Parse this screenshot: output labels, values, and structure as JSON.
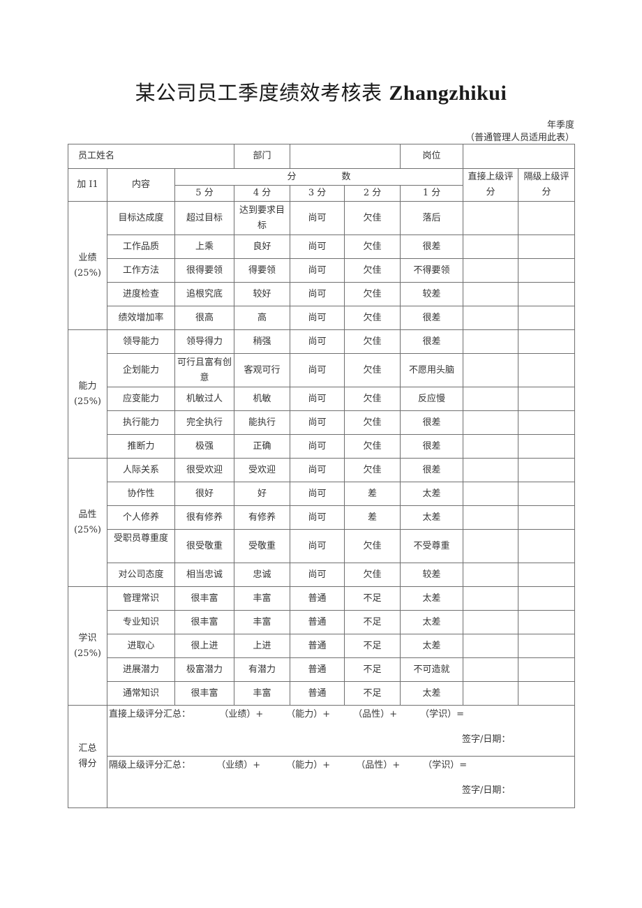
{
  "document": {
    "title_cn": "某公司员工季度绩效考核表",
    "title_latin": "Zhangzhikui",
    "season_label": "年季度",
    "applicability_note": "（普通管理人员适用此表）"
  },
  "header": {
    "employee_name_label": "员工姓名",
    "employee_name_value": "",
    "department_label": "部门",
    "department_value": "",
    "position_label": "岗位",
    "position_value": "",
    "item_label": "加 I1",
    "content_label": "内容",
    "score_group_label": "分　　　　　数",
    "score_columns": [
      "5 分",
      "4 分",
      "3 分",
      "2 分",
      "1 分"
    ],
    "direct_supervisor_label": "直接上级评分",
    "skip_supervisor_label": "隔级上级评分"
  },
  "categories": [
    {
      "name": "业绩",
      "weight": "(25%)",
      "items": [
        {
          "content": "目标达成度",
          "scores": [
            "超过目标",
            "达到要求目标",
            "尚可",
            "欠佳",
            "落后"
          ],
          "direct": "",
          "skip": ""
        },
        {
          "content": "工作品质",
          "scores": [
            "上乘",
            "良好",
            "尚可",
            "欠佳",
            "很差"
          ],
          "direct": "",
          "skip": ""
        },
        {
          "content": "工作方法",
          "scores": [
            "很得要领",
            "得要领",
            "尚可",
            "欠佳",
            "不得要领"
          ],
          "direct": "",
          "skip": ""
        },
        {
          "content": "进度检查",
          "scores": [
            "追根究底",
            "较好",
            "尚可",
            "欠佳",
            "较差"
          ],
          "direct": "",
          "skip": ""
        },
        {
          "content": "绩效增加率",
          "scores": [
            "很高",
            "高",
            "尚可",
            "欠佳",
            "很差"
          ],
          "direct": "",
          "skip": ""
        }
      ]
    },
    {
      "name": "能力",
      "weight": "(25%)",
      "items": [
        {
          "content": "领导能力",
          "scores": [
            "领导得力",
            "稍强",
            "尚可",
            "欠佳",
            "很差"
          ],
          "direct": "",
          "skip": ""
        },
        {
          "content": "企划能力",
          "scores": [
            "可行且富有创意",
            "客观可行",
            "尚可",
            "欠佳",
            "不愿用头脑"
          ],
          "direct": "",
          "skip": ""
        },
        {
          "content": "应变能力",
          "scores": [
            "机敏过人",
            "机敏",
            "尚可",
            "欠佳",
            "反应慢"
          ],
          "direct": "",
          "skip": ""
        },
        {
          "content": "执行能力",
          "scores": [
            "完全执行",
            "能执行",
            "尚可",
            "欠佳",
            "很差"
          ],
          "direct": "",
          "skip": ""
        },
        {
          "content": "推断力",
          "scores": [
            "极强",
            "正确",
            "尚可",
            "欠佳",
            "很差"
          ],
          "direct": "",
          "skip": ""
        }
      ]
    },
    {
      "name": "品性",
      "weight": "(25%)",
      "items": [
        {
          "content": "人际关系",
          "scores": [
            "很受欢迎",
            "受欢迎",
            "尚可",
            "欠佳",
            "很差"
          ],
          "direct": "",
          "skip": ""
        },
        {
          "content": "协作性",
          "scores": [
            "很好",
            "好",
            "尚可",
            "差",
            "太差"
          ],
          "direct": "",
          "skip": ""
        },
        {
          "content": "个人修养",
          "scores": [
            "很有修养",
            "有修养",
            "尚可",
            "差",
            "太差"
          ],
          "direct": "",
          "skip": ""
        },
        {
          "content": "受职员尊重度",
          "scores": [
            "很受敬重",
            "受敬重",
            "尚可",
            "欠佳",
            "不受尊重"
          ],
          "direct": "",
          "skip": ""
        },
        {
          "content": "对公司态度",
          "scores": [
            "相当忠诚",
            "忠诚",
            "尚可",
            "欠佳",
            "较差"
          ],
          "direct": "",
          "skip": ""
        }
      ]
    },
    {
      "name": "学识",
      "weight": "(25%)",
      "items": [
        {
          "content": "管理常识",
          "scores": [
            "很丰富",
            "丰富",
            "普通",
            "不足",
            "太差"
          ],
          "direct": "",
          "skip": ""
        },
        {
          "content": "专业知识",
          "scores": [
            "很丰富",
            "丰富",
            "普通",
            "不足",
            "太差"
          ],
          "direct": "",
          "skip": ""
        },
        {
          "content": "进取心",
          "scores": [
            "很上进",
            "上进",
            "普通",
            "不足",
            "太差"
          ],
          "direct": "",
          "skip": ""
        },
        {
          "content": "进展潜力",
          "scores": [
            "极富潜力",
            "有潜力",
            "普通",
            "不足",
            "不可造就"
          ],
          "direct": "",
          "skip": ""
        },
        {
          "content": "通常知识",
          "scores": [
            "很丰富",
            "丰富",
            "普通",
            "不足",
            "太差"
          ],
          "direct": "",
          "skip": ""
        }
      ]
    }
  ],
  "summary": {
    "label_line1": "汇总",
    "label_line2": "得分",
    "direct_formula": "直接上级评分汇总：          （业绩）+        （能力）+        （品性）+        （学识）=",
    "skip_formula": "隔级上级评分汇总：         （业绩）+         （能力）+         （品性）+        （学识）=",
    "signature_label": "签字/日期："
  }
}
